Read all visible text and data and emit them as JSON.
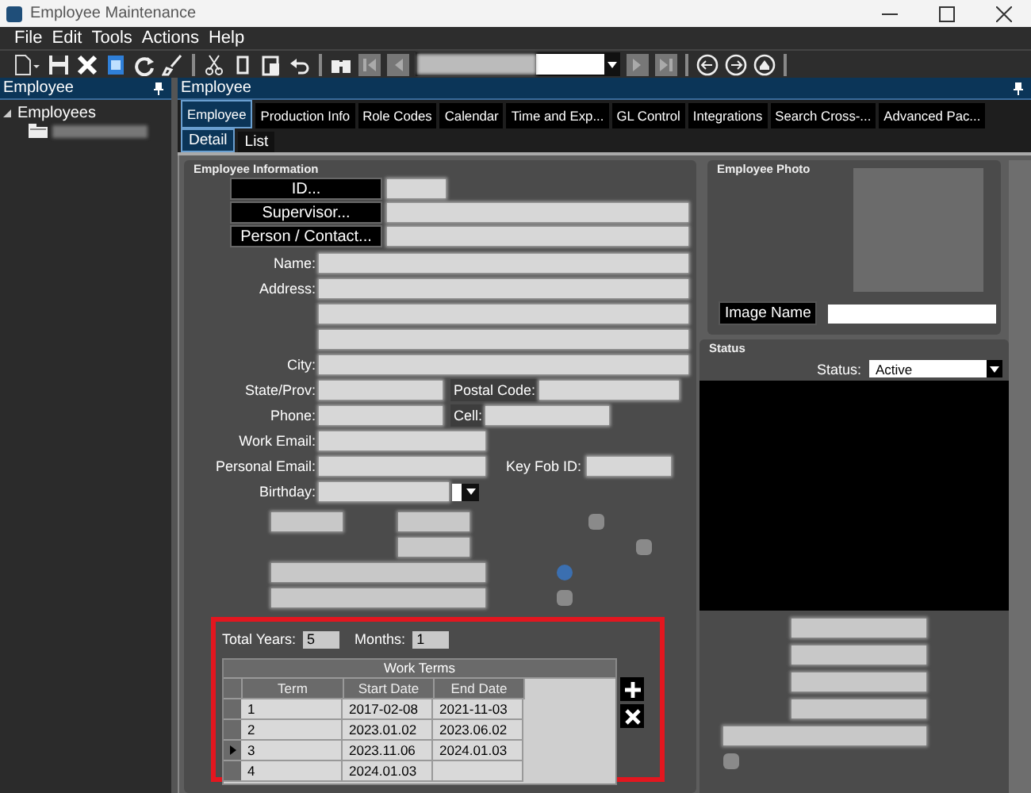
{
  "window": {
    "title": "Employee Maintenance"
  },
  "menu": [
    "File",
    "Edit",
    "Tools",
    "Actions",
    "Help"
  ],
  "left_panel": {
    "title": "Employee",
    "tree": [
      {
        "label": "Employees",
        "expanded": true,
        "children": [
          {
            "kind": "folder"
          }
        ]
      }
    ]
  },
  "main_panel": {
    "title": "Employee",
    "tabs": [
      {
        "label": "Employee",
        "selected": true
      },
      {
        "label": "Production Info",
        "selected": false
      },
      {
        "label": "Role Codes",
        "selected": false
      },
      {
        "label": "Calendar",
        "selected": false
      },
      {
        "label": "Time and Exp...",
        "selected": false
      },
      {
        "label": "GL Control",
        "selected": false
      },
      {
        "label": "Integrations",
        "selected": false
      },
      {
        "label": "Search  Cross-...",
        "selected": false
      },
      {
        "label": "Advanced Pac...",
        "selected": false
      }
    ],
    "subtabs": [
      {
        "label": "Detail",
        "selected": true
      },
      {
        "label": "List",
        "selected": false
      }
    ]
  },
  "info": {
    "title": "Employee Information",
    "lookup_buttons": [
      "ID...",
      "Supervisor...",
      "Person / Contact..."
    ],
    "labels": {
      "name": "Name:",
      "address": "Address:",
      "city": "City:",
      "state": "State/Prov:",
      "postal": "Postal Code:",
      "phone": "Phone:",
      "cell": "Cell:",
      "work_email": "Work Email:",
      "personal_email": "Personal Email:",
      "key_fob": "Key Fob ID:",
      "birthday": "Birthday:"
    }
  },
  "work_terms": {
    "total_years_label": "Total Years:",
    "total_years": "5",
    "months_label": "Months:",
    "months": "1",
    "title": "Work Terms",
    "columns": [
      "Term",
      "Start Date",
      "End Date"
    ],
    "rows": [
      {
        "term": "1",
        "start": "2017-02-08",
        "end": "2021-11-03",
        "selected": false
      },
      {
        "term": "2",
        "start": "2023.01.02",
        "end": "2023.06.02",
        "selected": false
      },
      {
        "term": "3",
        "start": "2023.11.06",
        "end": "2024.01.03",
        "selected": true
      },
      {
        "term": "4",
        "start": "2024.01.03",
        "selected": false
      }
    ]
  },
  "photo": {
    "title": "Employee Photo",
    "image_name_button": "Image Name"
  },
  "status": {
    "title": "Status",
    "label": "Status:",
    "value": "Active"
  }
}
